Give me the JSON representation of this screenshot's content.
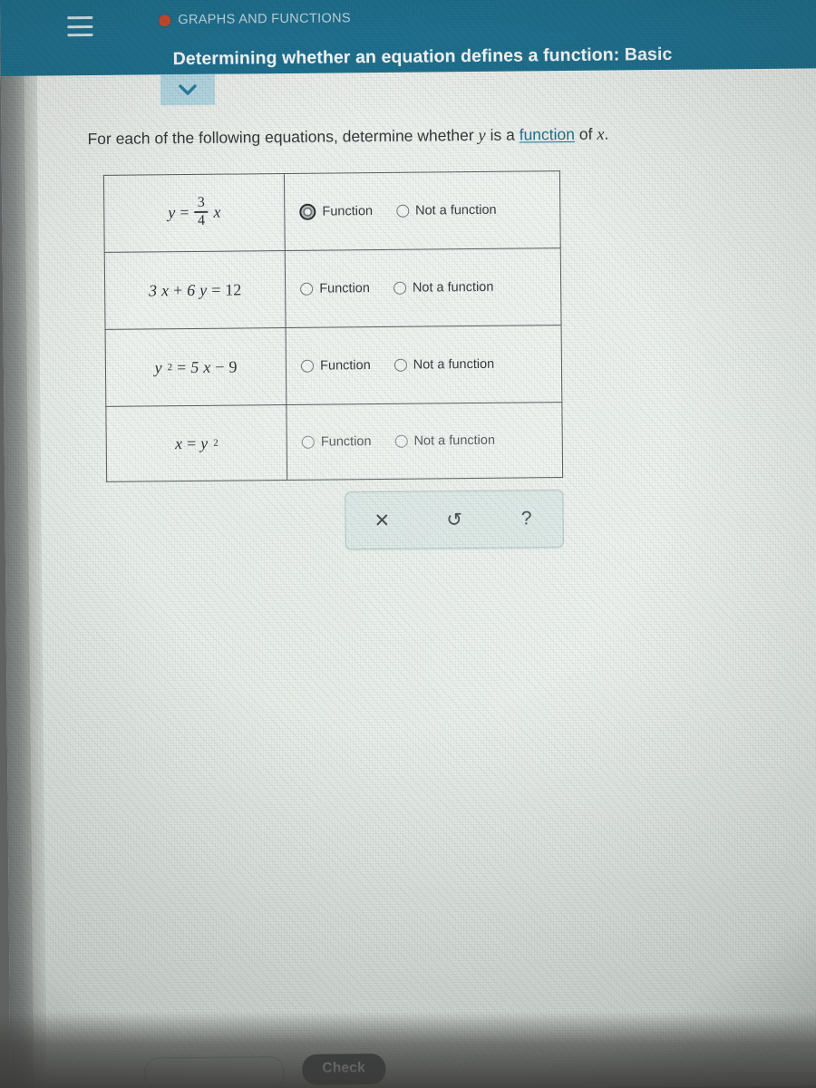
{
  "header": {
    "kicker": "GRAPHS AND FUNCTIONS",
    "title": "Determining whether an equation defines a function: Basic",
    "menu_icon": "hamburger-icon",
    "status_dot": "red-record-dot-icon",
    "accent_color": "#1f7391",
    "text_color": "#ffffff"
  },
  "collapse_tab": {
    "icon": "chevron-down-icon",
    "color": "#b8dbe6"
  },
  "prompt": {
    "part1": "For each of the following equations, determine whether ",
    "var_y": "y",
    "part2": " is a ",
    "link": "function",
    "part3": " of ",
    "var_x": "x",
    "part4": "."
  },
  "table": {
    "option_function": "Function",
    "option_not_a_function": "Not a function",
    "rows": [
      {
        "equation_text": "y = 3/4 x",
        "lhs": "y",
        "operator": "=",
        "numerator": "3",
        "denominator": "4",
        "trailing_var": "x",
        "selected": null,
        "focused_option": "Function"
      },
      {
        "equation_text": "3x + 6y = 12",
        "coefficient_x": "3",
        "var_x": "x",
        "plus": "+",
        "coefficient_y": "6",
        "var_y": "y",
        "equals": "=",
        "constant": "12",
        "selected": null,
        "focused_option": null
      },
      {
        "equation_text": "y^2 = 5x - 9",
        "lhs_var": "y",
        "lhs_exp": "2",
        "equals": "=",
        "rhs_coefficient": "5",
        "rhs_var": "x",
        "minus": "−",
        "rhs_constant": "9",
        "selected": null,
        "focused_option": null
      },
      {
        "equation_text": "x = y^2",
        "lhs_var": "x",
        "equals": "=",
        "rhs_var": "y",
        "rhs_exp": "2",
        "selected": null,
        "focused_option": null
      }
    ]
  },
  "toolstrip": {
    "clear_icon": "x-icon",
    "clear_glyph": "✕",
    "undo_icon": "undo-arrow-icon",
    "undo_glyph": "↺",
    "help_icon": "question-mark-icon",
    "help_glyph": "?"
  },
  "bottom": {
    "check_label": "Check",
    "secondary_label": ""
  }
}
